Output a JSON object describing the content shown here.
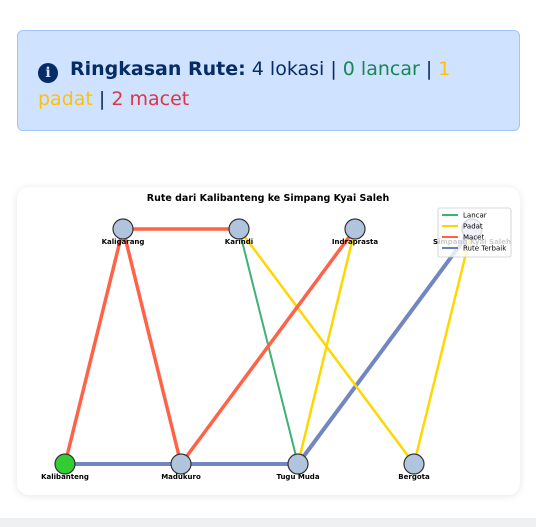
{
  "summary": {
    "title": "Ringkasan Rute:",
    "locations": "4 lokasi",
    "sep1": " | ",
    "lancar": "0 lancar",
    "sep2": " | ",
    "padat": "1 padat",
    "sep3": " | ",
    "macet": "2 macet",
    "icon": "info-circle-icon"
  },
  "graph": {
    "title": "Rute dari Kalibanteng ke Simpang Kyai Saleh",
    "legend": [
      "Lancar",
      "Padat",
      "Macet",
      "Rute Terbaik"
    ],
    "colors": {
      "Lancar": "#3cb371",
      "Padat": "#ffd700",
      "Macet": "#ff6347",
      "Rute Terbaik": "#6a7fbf",
      "node": "#b0c4de",
      "start": "#32cd32"
    },
    "nodes": [
      {
        "id": "Kaligarang",
        "label": "Kaligarang"
      },
      {
        "id": "Karindi",
        "label": "Karindi"
      },
      {
        "id": "Indraprasta",
        "label": "Indraprasta"
      },
      {
        "id": "Simpang Kyai Saleh",
        "label": "Simpang Kyai Saleh"
      },
      {
        "id": "Kalibanteng",
        "label": "Kalibanteng",
        "start": true
      },
      {
        "id": "Madukuro",
        "label": "Madukuro"
      },
      {
        "id": "Tugu Muda",
        "label": "Tugu Muda"
      },
      {
        "id": "Bergota",
        "label": "Bergota"
      }
    ],
    "edges": [
      {
        "from": "Kaligarang",
        "to": "Karindi",
        "status": "Macet"
      },
      {
        "from": "Kaligarang",
        "to": "Kalibanteng",
        "status": "Macet"
      },
      {
        "from": "Kaligarang",
        "to": "Madukuro",
        "status": "Macet"
      },
      {
        "from": "Madukuro",
        "to": "Indraprasta",
        "status": "Macet"
      },
      {
        "from": "Karindi",
        "to": "Tugu Muda",
        "status": "Lancar"
      },
      {
        "from": "Karindi",
        "to": "Bergota",
        "status": "Padat"
      },
      {
        "from": "Indraprasta",
        "to": "Tugu Muda",
        "status": "Padat"
      },
      {
        "from": "Simpang Kyai Saleh",
        "to": "Bergota",
        "status": "Padat"
      },
      {
        "from": "Kalibanteng",
        "to": "Madukuro",
        "status": "Rute Terbaik"
      },
      {
        "from": "Madukuro",
        "to": "Tugu Muda",
        "status": "Rute Terbaik"
      },
      {
        "from": "Tugu Muda",
        "to": "Simpang Kyai Saleh",
        "status": "Rute Terbaik"
      }
    ]
  }
}
